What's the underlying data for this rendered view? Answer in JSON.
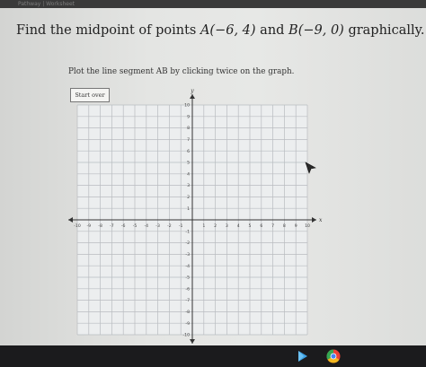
{
  "tab": {
    "title": "Pathway | Worksheet"
  },
  "question": {
    "prefix": "Find the midpoint of points ",
    "pointA": "A(−6, 4)",
    "middle": " and ",
    "pointB": "B(−9, 0)",
    "suffix": " graphically."
  },
  "instruction": "Plot the line segment AB by clicking twice on the graph.",
  "start_button": "Start over",
  "graph": {
    "x_axis_label": "x",
    "y_axis_label": "y",
    "x_range": [
      -10,
      10
    ],
    "y_range": [
      -10,
      10
    ],
    "x_tick_labels": [
      "-10",
      "-9",
      "-8",
      "-7",
      "-6",
      "-5",
      "-4",
      "-3",
      "-2",
      "-1",
      "1",
      "2",
      "3",
      "4",
      "5",
      "6",
      "7",
      "8",
      "9",
      "10"
    ],
    "y_tick_labels": [
      "10",
      "9",
      "8",
      "7",
      "6",
      "5",
      "4",
      "3",
      "2",
      "1",
      "-1",
      "-2",
      "-3",
      "-4",
      "-5",
      "-6",
      "-7",
      "-8",
      "-9",
      "-10"
    ],
    "grid_color": "#b9bcc0",
    "axis_color": "#333333"
  },
  "taskbar": {
    "icons": [
      "play-store-icon",
      "chrome-icon"
    ]
  }
}
